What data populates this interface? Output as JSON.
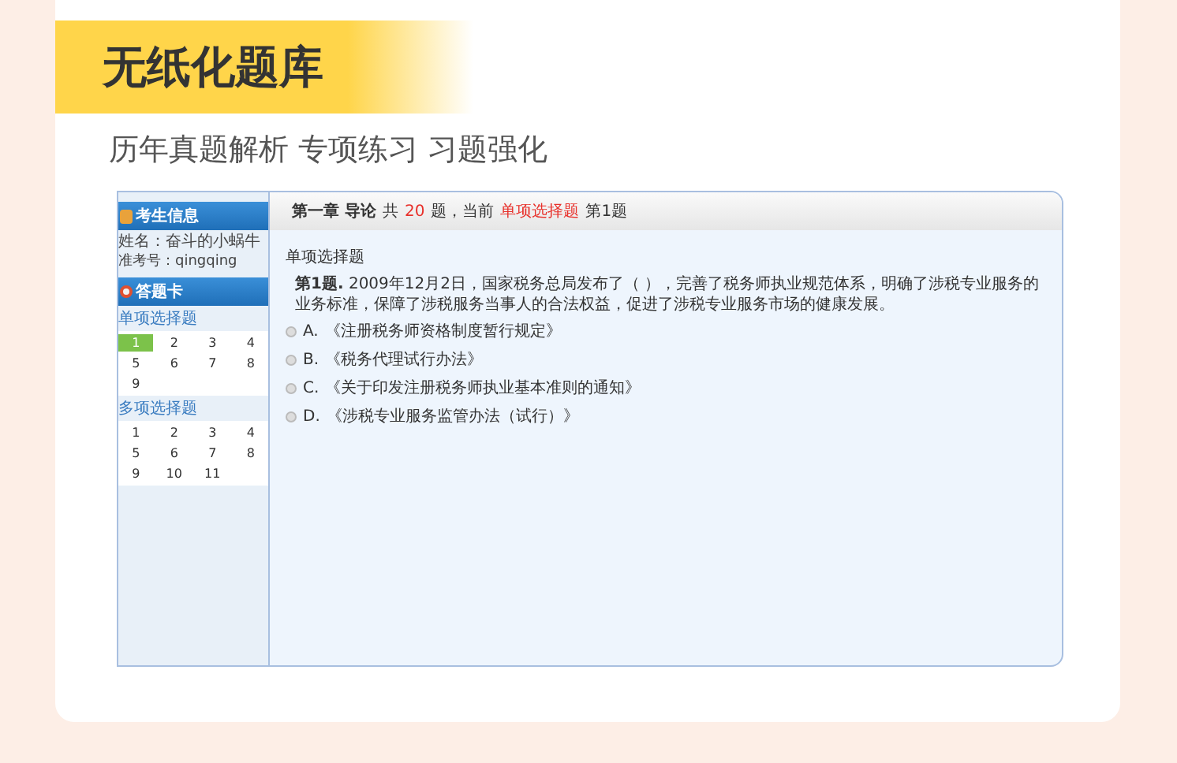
{
  "banner": {
    "title": "无纸化题库",
    "subtitle": "历年真题解析 专项练习 习题强化"
  },
  "exam": {
    "sidebar": {
      "info_title": "考生信息",
      "name_line": "姓名：奋斗的小蜗牛",
      "id_line": "准考号：qingqing",
      "card_title": "答题卡",
      "sections": [
        {
          "title": "单项选择题",
          "numbers": [
            {
              "label": "1",
              "selected": true
            },
            {
              "label": "2",
              "selected": false
            },
            {
              "label": "3",
              "selected": false
            },
            {
              "label": "4",
              "selected": false
            },
            {
              "label": "5",
              "selected": false
            },
            {
              "label": "6",
              "selected": false
            },
            {
              "label": "7",
              "selected": false
            },
            {
              "label": "8",
              "selected": false
            },
            {
              "label": "9",
              "selected": false
            }
          ]
        },
        {
          "title": "多项选择题",
          "numbers": [
            {
              "label": "1",
              "selected": false
            },
            {
              "label": "2",
              "selected": false
            },
            {
              "label": "3",
              "selected": false
            },
            {
              "label": "4",
              "selected": false
            },
            {
              "label": "5",
              "selected": false
            },
            {
              "label": "6",
              "selected": false
            },
            {
              "label": "7",
              "selected": false
            },
            {
              "label": "8",
              "selected": false
            },
            {
              "label": "9",
              "selected": false
            },
            {
              "label": "10",
              "selected": false
            },
            {
              "label": "11",
              "selected": false
            }
          ]
        }
      ]
    },
    "header": [
      {
        "text": "第一章 导论",
        "highlight": false
      },
      {
        "text": "共",
        "highlight": false
      },
      {
        "text": "20",
        "highlight": true
      },
      {
        "text": "题，当前",
        "highlight": false
      },
      {
        "text": "单项选择题",
        "highlight": true
      },
      {
        "text": "第1题",
        "highlight": false
      }
    ],
    "question": {
      "type": "单项选择题",
      "number": "第1题.",
      "text": "2009年12月2日，国家税务总局发布了（ ），完善了税务师执业规范体系，明确了涉税专业服务的业务标准，保障了涉税服务当事人的合法权益，促进了涉税专业服务市场的健康发展。",
      "options": [
        {
          "letter": "A.",
          "text": "《注册税务师资格制度暂行规定》",
          "selected": false
        },
        {
          "letter": "B.",
          "text": "《税务代理试行办法》",
          "selected": false
        },
        {
          "letter": "C.",
          "text": "《关于印发注册税务师执业基本准则的通知》",
          "selected": false
        },
        {
          "letter": "D.",
          "text": "《涉税专业服务监管办法（试行）》",
          "selected": false
        }
      ]
    }
  }
}
